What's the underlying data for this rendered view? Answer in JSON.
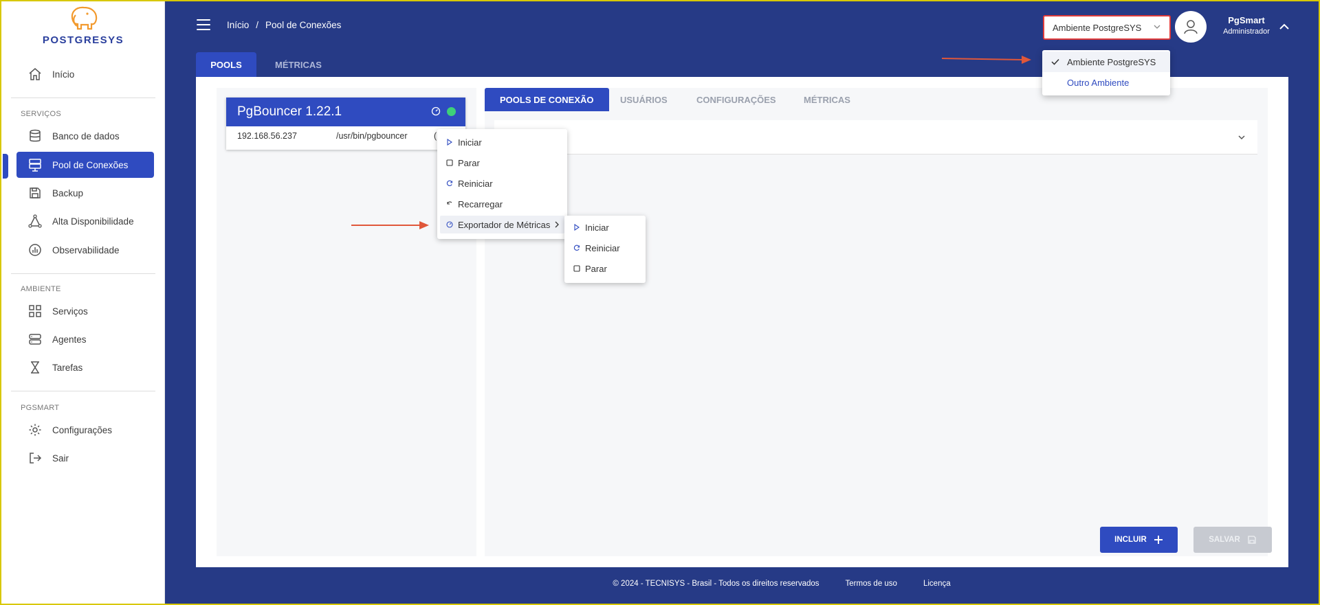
{
  "brand": {
    "logo_text": "POSTGRESYS"
  },
  "sidebar": {
    "home": "Início",
    "sections": {
      "services": "SERVIÇOS",
      "environment": "AMBIENTE",
      "pgsmart": "PGSMART"
    },
    "services_items": [
      {
        "label": "Banco de dados",
        "icon": "database-icon"
      },
      {
        "label": "Pool de Conexões",
        "icon": "server-icon",
        "active": true
      },
      {
        "label": "Backup",
        "icon": "save-icon"
      },
      {
        "label": "Alta Disponibilidade",
        "icon": "triangle-nodes-icon"
      },
      {
        "label": "Observabilidade",
        "icon": "chart-icon"
      }
    ],
    "environment_items": [
      {
        "label": "Serviços",
        "icon": "grid-icon"
      },
      {
        "label": "Agentes",
        "icon": "agents-icon"
      },
      {
        "label": "Tarefas",
        "icon": "hourglass-icon"
      }
    ],
    "pgsmart_items": [
      {
        "label": "Configurações",
        "icon": "gear-icon"
      },
      {
        "label": "Sair",
        "icon": "logout-icon"
      }
    ]
  },
  "header": {
    "breadcrumb": [
      "Início",
      "/",
      "Pool de Conexões"
    ],
    "environment_selected": "Ambiente PostgreSYS",
    "user": {
      "name": "PgSmart",
      "role": "Administrador"
    }
  },
  "environment_dropdown": {
    "options": [
      "Ambiente PostgreSYS",
      "Outro Ambiente"
    ]
  },
  "top_tabs": [
    "POOLS",
    "MÉTRICAS"
  ],
  "pool": {
    "title": "PgBouncer 1.22.1",
    "status_color": "#3ed079",
    "ip": "192.168.56.237",
    "path": "/usr/bin/pgbouncer",
    "truncated": "("
  },
  "sub_tabs": [
    "POOLS DE CONEXÃO",
    "USUÁRIOS",
    "CONFIGURAÇÕES",
    "MÉTRICAS"
  ],
  "context_menu": {
    "items": [
      "Iniciar",
      "Parar",
      "Reiniciar",
      "Recarregar",
      "Exportador de Métricas"
    ]
  },
  "submenu": {
    "items": [
      "Iniciar",
      "Reiniciar",
      "Parar"
    ]
  },
  "buttons": {
    "incluir": "INCLUIR",
    "salvar": "SALVAR"
  },
  "footer": {
    "copyright": "© 2024 - TECNISYS - Brasil - Todos os direitos reservados",
    "terms": "Termos de uso",
    "license": "Licença"
  },
  "colors": {
    "primary": "#2f4bc0",
    "background": "#263a86",
    "annotation_arrow": "#e0573a",
    "highlight_border": "#e03a3a"
  }
}
